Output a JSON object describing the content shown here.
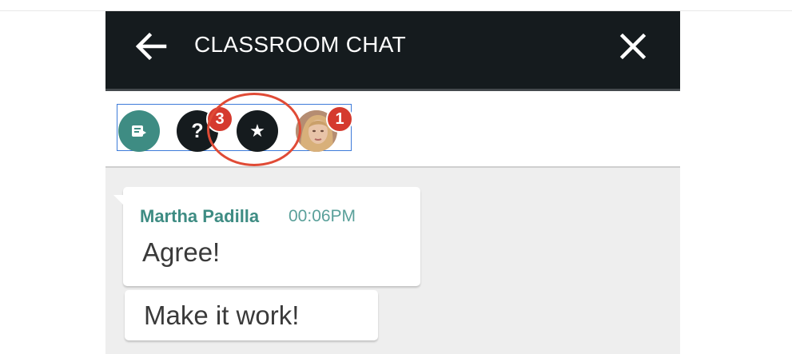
{
  "header": {
    "title": "CLASSROOM CHAT",
    "back_icon": "arrow-left-icon",
    "close_icon": "close-icon"
  },
  "toolbar": {
    "tools": [
      {
        "name": "notes",
        "icon": "note-edit-icon",
        "color": "#3e8c83"
      },
      {
        "name": "questions",
        "icon_glyph": "?",
        "badge": "3"
      },
      {
        "name": "starred",
        "icon_glyph": "★"
      },
      {
        "name": "user",
        "icon": "avatar",
        "badge": "1"
      }
    ]
  },
  "messages": [
    {
      "sender": "Martha Padilla",
      "time": "00:06PM",
      "text": "Agree!"
    },
    {
      "text": "Make it work!"
    }
  ],
  "colors": {
    "header_bg": "#151b1e",
    "accent_teal": "#3e8c83",
    "badge_red": "#d53a2e",
    "highlight_ring": "#e04b36",
    "selection_blue": "#3d7bd9",
    "chat_bg": "#eeeeee"
  }
}
